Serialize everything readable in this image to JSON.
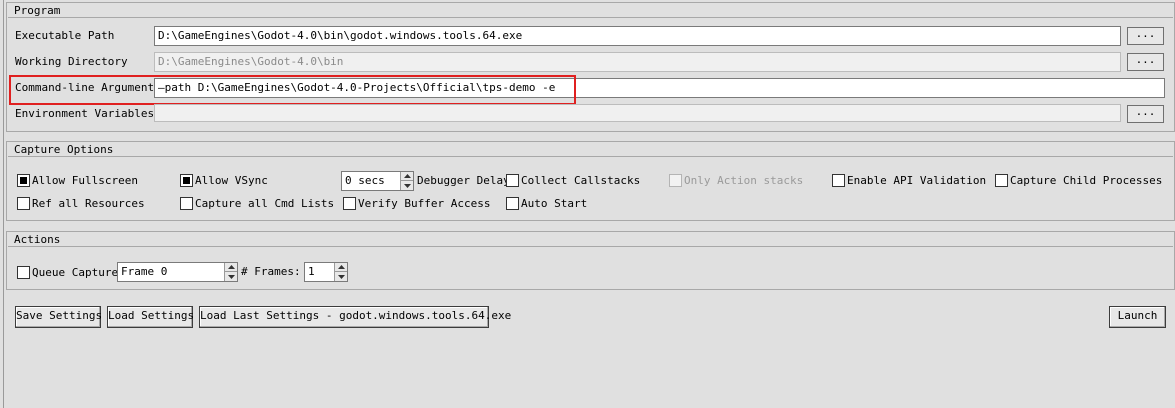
{
  "program": {
    "title": "Program",
    "executable_path": {
      "label": "Executable Path",
      "value": "D:\\GameEngines\\Godot-4.0\\bin\\godot.windows.tools.64.exe",
      "browse_label": "..."
    },
    "working_directory": {
      "label": "Working Directory",
      "placeholder": "D:\\GameEngines\\Godot-4.0\\bin",
      "browse_label": "..."
    },
    "command_line_arguments": {
      "label": "Command-line Arguments",
      "value": "—path D:\\GameEngines\\Godot-4.0-Projects\\Official\\tps-demo -e"
    },
    "environment_variables": {
      "label": "Environment Variables",
      "value": "",
      "browse_label": "..."
    }
  },
  "capture_options": {
    "title": "Capture Options",
    "allow_fullscreen": {
      "label": "Allow Fullscreen",
      "checked": true
    },
    "allow_vsync": {
      "label": "Allow VSync",
      "checked": true
    },
    "debugger_delay": {
      "value": "0 secs",
      "label": "Debugger Delay"
    },
    "collect_callstacks": {
      "label": "Collect Callstacks",
      "checked": false
    },
    "only_action_stacks": {
      "label": "Only Action stacks",
      "checked": false,
      "disabled": true
    },
    "enable_api_validation": {
      "label": "Enable API Validation",
      "checked": false
    },
    "capture_child_processes": {
      "label": "Capture Child Processes",
      "checked": false
    },
    "ref_all_resources": {
      "label": "Ref all Resources",
      "checked": false
    },
    "capture_all_cmd_lists": {
      "label": "Capture all Cmd Lists",
      "checked": false
    },
    "verify_buffer_access": {
      "label": "Verify Buffer Access",
      "checked": false
    },
    "auto_start": {
      "label": "Auto Start",
      "checked": false
    }
  },
  "actions": {
    "title": "Actions",
    "queue_capture": {
      "label": "Queue Capture",
      "checked": false
    },
    "frame": {
      "value": "Frame 0"
    },
    "frames": {
      "label": "# Frames:",
      "value": "1"
    }
  },
  "footer": {
    "save_settings": "Save Settings",
    "load_settings": "Load Settings",
    "load_last_settings": "Load Last Settings - godot.windows.tools.64.exe",
    "launch": "Launch"
  },
  "colors": {
    "highlight": "#e02020",
    "panel": "#e0e0e0"
  }
}
